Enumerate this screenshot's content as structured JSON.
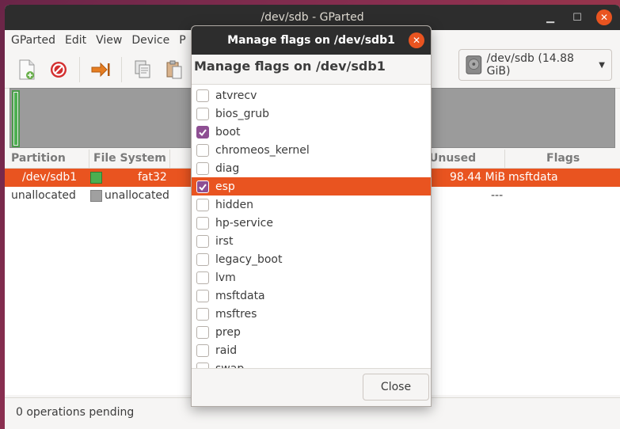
{
  "window": {
    "title": "/dev/sdb - GParted"
  },
  "menubar": {
    "items": [
      "GParted",
      "Edit",
      "View",
      "Device",
      "P"
    ]
  },
  "device_selector": {
    "label": "/dev/sdb (14.88 GiB)"
  },
  "table": {
    "headers": {
      "partition": "Partition",
      "filesystem": "File System",
      "unused": "Unused",
      "flags": "Flags"
    },
    "rows": [
      {
        "partition": "/dev/sdb1",
        "filesystem": "fat32",
        "unused": "98.44 MiB",
        "flags": "msftdata",
        "color": "#4caf50"
      },
      {
        "partition": "unallocated",
        "filesystem": "unallocated",
        "unused": "---",
        "flags": "",
        "color": "#a0a0a0"
      }
    ]
  },
  "statusbar": {
    "text": "0 operations pending"
  },
  "dialog": {
    "title": "Manage flags on /dev/sdb1",
    "heading": "Manage flags on /dev/sdb1",
    "flags": [
      {
        "name": "atvrecv",
        "checked": false
      },
      {
        "name": "bios_grub",
        "checked": false
      },
      {
        "name": "boot",
        "checked": true
      },
      {
        "name": "chromeos_kernel",
        "checked": false
      },
      {
        "name": "diag",
        "checked": false
      },
      {
        "name": "esp",
        "checked": true,
        "highlighted": true
      },
      {
        "name": "hidden",
        "checked": false
      },
      {
        "name": "hp-service",
        "checked": false
      },
      {
        "name": "irst",
        "checked": false
      },
      {
        "name": "legacy_boot",
        "checked": false
      },
      {
        "name": "lvm",
        "checked": false
      },
      {
        "name": "msftdata",
        "checked": false
      },
      {
        "name": "msftres",
        "checked": false
      },
      {
        "name": "prep",
        "checked": false
      },
      {
        "name": "raid",
        "checked": false
      },
      {
        "name": "swap",
        "checked": false
      }
    ],
    "close_label": "Close"
  },
  "colors": {
    "accent": "#e95420",
    "check": "#8e4f93",
    "titlebar": "#2d2d2d"
  },
  "icons": [
    "new-icon",
    "delete-icon",
    "apply-icon",
    "copy-icon",
    "paste-icon",
    "disk-icon",
    "chevron-down-icon",
    "close-icon",
    "minimize-icon",
    "maximize-icon"
  ]
}
